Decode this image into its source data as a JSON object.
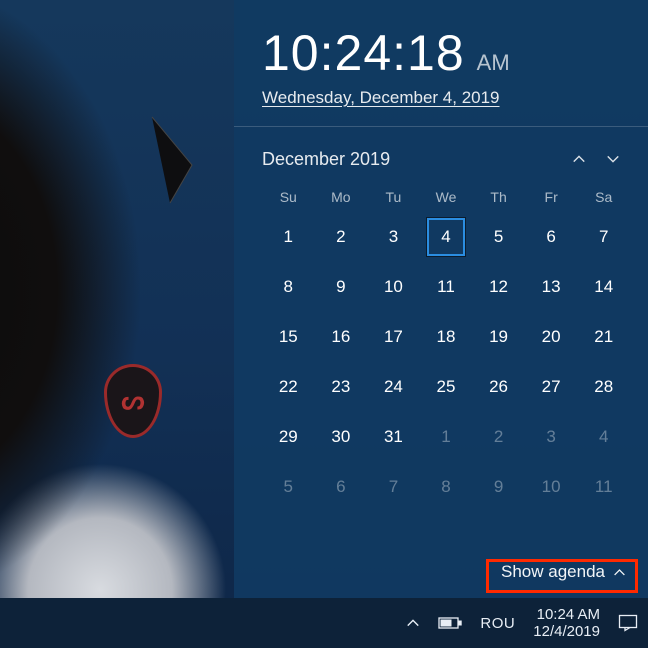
{
  "clock": {
    "time": "10:24:18",
    "ampm": "AM",
    "date_line": "Wednesday, December 4, 2019"
  },
  "calendar": {
    "title": "December 2019",
    "dow": [
      "Su",
      "Mo",
      "Tu",
      "We",
      "Th",
      "Fr",
      "Sa"
    ],
    "weeks": [
      [
        {
          "n": "1"
        },
        {
          "n": "2"
        },
        {
          "n": "3"
        },
        {
          "n": "4",
          "today": true
        },
        {
          "n": "5"
        },
        {
          "n": "6"
        },
        {
          "n": "7"
        }
      ],
      [
        {
          "n": "8"
        },
        {
          "n": "9"
        },
        {
          "n": "10"
        },
        {
          "n": "11"
        },
        {
          "n": "12"
        },
        {
          "n": "13"
        },
        {
          "n": "14"
        }
      ],
      [
        {
          "n": "15"
        },
        {
          "n": "16"
        },
        {
          "n": "17"
        },
        {
          "n": "18"
        },
        {
          "n": "19"
        },
        {
          "n": "20"
        },
        {
          "n": "21"
        }
      ],
      [
        {
          "n": "22"
        },
        {
          "n": "23"
        },
        {
          "n": "24"
        },
        {
          "n": "25"
        },
        {
          "n": "26"
        },
        {
          "n": "27"
        },
        {
          "n": "28"
        }
      ],
      [
        {
          "n": "29"
        },
        {
          "n": "30"
        },
        {
          "n": "31"
        },
        {
          "n": "1",
          "other": true
        },
        {
          "n": "2",
          "other": true
        },
        {
          "n": "3",
          "other": true
        },
        {
          "n": "4",
          "other": true
        }
      ],
      [
        {
          "n": "5",
          "other": true
        },
        {
          "n": "6",
          "other": true
        },
        {
          "n": "7",
          "other": true
        },
        {
          "n": "8",
          "other": true
        },
        {
          "n": "9",
          "other": true
        },
        {
          "n": "10",
          "other": true
        },
        {
          "n": "11",
          "other": true
        }
      ]
    ],
    "agenda_label": "Show agenda"
  },
  "taskbar": {
    "ime": "ROU",
    "tray_time": "10:24 AM",
    "tray_date": "12/4/2019"
  }
}
